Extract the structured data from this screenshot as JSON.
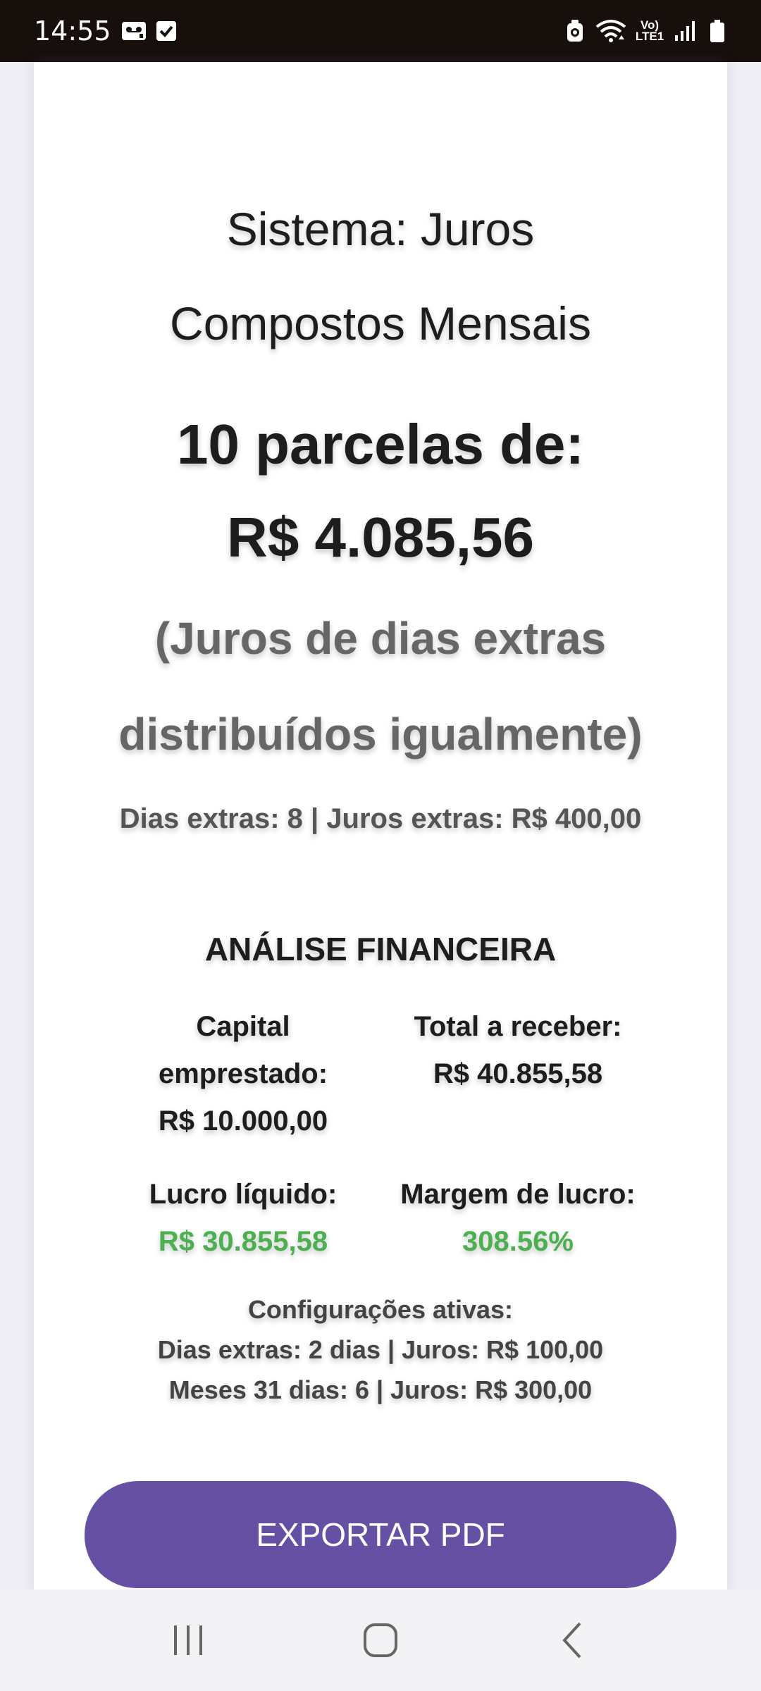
{
  "status_bar": {
    "time": "14:55",
    "network_label": "Vo) LTE1",
    "left_icons": [
      "voicemail-icon",
      "checkbox-icon"
    ],
    "right_icons": [
      "alarm-icon",
      "wifi-icon",
      "volte-icon",
      "signal-icon",
      "battery-icon"
    ]
  },
  "header": {
    "sistema_line1": "Sistema: Juros",
    "sistema_line2": "Compostos Mensais",
    "parcelas_line1": "10 parcelas de:",
    "parcelas_line2": "R$ 4.085,56",
    "note_line1": "(Juros de dias extras",
    "note_line2": "distribuídos igualmente)",
    "extras": "Dias extras: 8 | Juros extras: R$ 400,00"
  },
  "analise": {
    "title": "ANÁLISE FINANCEIRA",
    "capital_label_1": "Capital",
    "capital_label_2": "emprestado:",
    "capital_value": "R$ 10.000,00",
    "total_label": "Total a receber:",
    "total_value": "R$ 40.855,58",
    "lucro_label": "Lucro líquido:",
    "lucro_value": "R$ 30.855,58",
    "margem_label": "Margem de lucro:",
    "margem_value": "308.56%"
  },
  "config": {
    "title": "Configurações ativas:",
    "line1": "Dias extras: 2 dias | Juros: R$ 100,00",
    "line2": "Meses 31 dias: 6 | Juros: R$ 300,00"
  },
  "actions": {
    "export_label": "EXPORTAR PDF"
  },
  "nav_bar": {
    "icons": [
      "recent-apps-icon",
      "home-icon",
      "back-icon"
    ]
  },
  "colors": {
    "accent": "#6650a3",
    "positive": "#4caf50",
    "status_bar": "#160f0c"
  }
}
